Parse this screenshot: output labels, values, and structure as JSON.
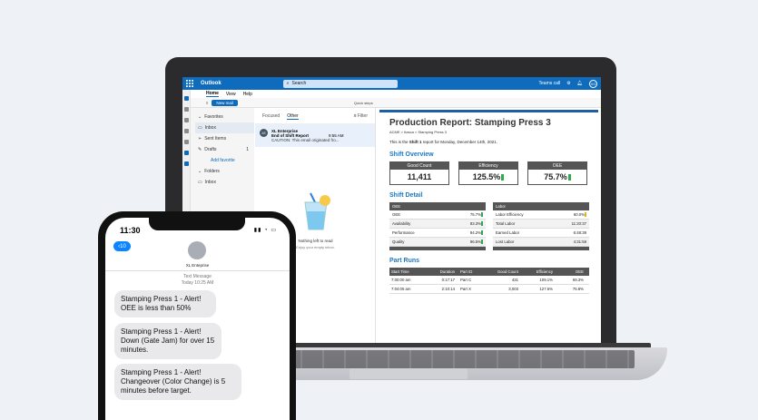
{
  "outlook": {
    "app_name": "Outlook",
    "search_placeholder": "Search",
    "teams_call": "Teams call",
    "avatar_initials": "XO",
    "menu": [
      "Home",
      "View",
      "Help"
    ],
    "new_mail": "New mail",
    "quick_steps": "Quick steps",
    "folders": {
      "favorites": "Favorites",
      "inbox": "Inbox",
      "sent": "Sent Items",
      "drafts": "Drafts",
      "drafts_count": "1",
      "add_favorite": "Add favorite",
      "folders_header": "Folders",
      "inbox2": "Inbox"
    },
    "list": {
      "tab_focused": "Focused",
      "tab_other": "Other",
      "filter": "Filter",
      "sender_initials": "XE",
      "sender": "XL Enterprise",
      "subject": "End of Shift Report",
      "time": "9:55 AM",
      "preview": "CAUTION: This email originated fro...",
      "empty_title": "Nothing left to read",
      "empty_sub": "Enjoy your empty inbox."
    }
  },
  "report": {
    "title": "Production Report: Stamping Press 3",
    "crumb": "ACME > Itasca > Stamping Press 3",
    "intro_pre": "This is the ",
    "intro_shift": "Shift 1",
    "intro_post": " report for Monday, December 14th, 2021.",
    "overview_title": "Shift Overview",
    "kpis": [
      {
        "label": "Good Count",
        "value": "11,411"
      },
      {
        "label": "Efficiency",
        "value": "125.5%"
      },
      {
        "label": "OEE",
        "value": "75.7%"
      }
    ],
    "detail_title": "Shift Detail",
    "oee_table": {
      "header": "OEE",
      "rows": [
        {
          "k": "OEE",
          "v": "75.7%"
        },
        {
          "k": "Availability",
          "v": "83.3%"
        },
        {
          "k": "Performance",
          "v": "94.2%"
        },
        {
          "k": "Quality",
          "v": "96.5%"
        }
      ]
    },
    "labor_table": {
      "header": "Labor",
      "rows": [
        {
          "k": "Labor Efficiency",
          "v": "60.0%"
        },
        {
          "k": "Total Labor",
          "v": "11:20:37"
        },
        {
          "k": "Earned Labor",
          "v": "6:48:39"
        },
        {
          "k": "Lost Labor",
          "v": "4:31:59"
        }
      ]
    },
    "runs_title": "Part Runs",
    "runs_headers": [
      "Start Time",
      "Duration",
      "Part ID",
      "Good Count",
      "Efficiency",
      "OEE"
    ],
    "runs": [
      [
        "7:00:00 am",
        "0:17:17",
        "Part C",
        "431",
        "109.1%",
        "69.3%"
      ],
      [
        "7:04:05 am",
        "2:10:14",
        "Part X",
        "3,003",
        "127.6%",
        "75.8%"
      ]
    ]
  },
  "phone": {
    "time": "11:30",
    "back_count": "10",
    "contact": "XL Enteprise",
    "msg_label": "Text Message",
    "msg_time": "Today 10:25 AM",
    "messages": [
      "Stamping Press 1 - Alert! OEE is less than 50%",
      "Stamping Press 1 - Alert! Down (Gate Jam) for over 15 minutes.",
      "Stamping Press 1 - Alert! Changeover (Color Change) is 5 minutes before target."
    ]
  }
}
